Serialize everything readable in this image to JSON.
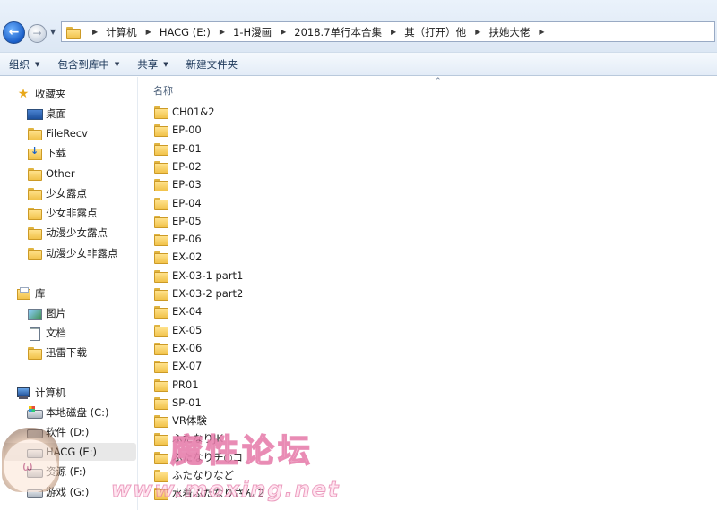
{
  "nav": {
    "back": "back-button",
    "forward": "forward-button",
    "recent": "recent-pages"
  },
  "address": {
    "crumbs": [
      "计算机",
      "HACG (E:)",
      "1-H漫画",
      "2018.7单行本合集",
      "其（打开）他",
      "扶她大佬"
    ]
  },
  "toolbar": {
    "organize": "组织",
    "include_library": "包含到库中",
    "share": "共享",
    "new_folder": "新建文件夹"
  },
  "sidebar": {
    "favorites": {
      "label": "收藏夹",
      "items": [
        "桌面",
        "FileRecv",
        "下载",
        "Other",
        "少女露点",
        "少女非露点",
        "动漫少女露点",
        "动漫少女非露点"
      ]
    },
    "libraries": {
      "label": "库",
      "items": [
        "图片",
        "文档",
        "迅雷下载"
      ]
    },
    "computer": {
      "label": "计算机",
      "items": [
        "本地磁盘 (C:)",
        "软件 (D:)",
        "HACG (E:)",
        "资源 (F:)",
        "游戏 (G:)"
      ],
      "selected": "HACG (E:)"
    }
  },
  "main": {
    "column_name": "名称",
    "files": [
      "CH01&2",
      "EP-00",
      "EP-01",
      "EP-02",
      "EP-03",
      "EP-04",
      "EP-05",
      "EP-06",
      "EX-02",
      "EX-03-1 part1",
      "EX-03-2 part2",
      "EX-04",
      "EX-05",
      "EX-06",
      "EX-07",
      "PR01",
      "SP-01",
      "VR体験",
      "ふたなりJK",
      "ふたなりチ○コ",
      "ふたなりなど",
      "水着ふたなりさん 2"
    ]
  },
  "watermark": {
    "title": "魔性论坛",
    "url": "www.moxing.net"
  },
  "colors": {
    "toolbar_text": "#1e395b",
    "folder": "#f1c24a",
    "selection": "#e8e8e8",
    "accent": "#1a5fc9"
  }
}
